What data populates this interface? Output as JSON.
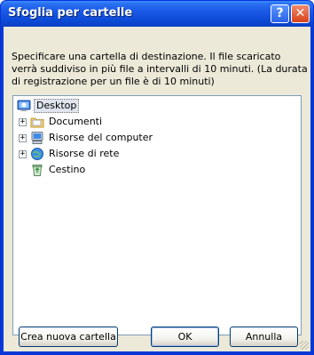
{
  "window": {
    "title": "Sfoglia per cartelle",
    "help_glyph": "?",
    "close_glyph": "✕"
  },
  "description": {
    "lines": [
      "Specificare una cartella di destinazione. Il file scaricato",
      "verrà suddiviso in più file a intervalli di 10 minuti. (La durata",
      "di registrazione per un file è di 10 minuti)"
    ]
  },
  "tree": {
    "items": [
      {
        "label": "Desktop",
        "icon": "desktop-icon",
        "selected": true,
        "expandable": false
      },
      {
        "label": "Documenti",
        "icon": "folder-icon",
        "selected": false,
        "expandable": true
      },
      {
        "label": "Risorse del computer",
        "icon": "computer-icon",
        "selected": false,
        "expandable": true
      },
      {
        "label": "Risorse di rete",
        "icon": "network-icon",
        "selected": false,
        "expandable": true
      },
      {
        "label": "Cestino",
        "icon": "recycle-bin-icon",
        "selected": false,
        "expandable": false
      }
    ],
    "expand_glyph": "+"
  },
  "buttons": {
    "new_folder": "Crea nuova cartella",
    "ok": "OK",
    "cancel": "Annulla"
  },
  "colors": {
    "titlebar": "#0a3fc4",
    "client": "#ece9d8",
    "tree_border": "#7f9db9"
  }
}
